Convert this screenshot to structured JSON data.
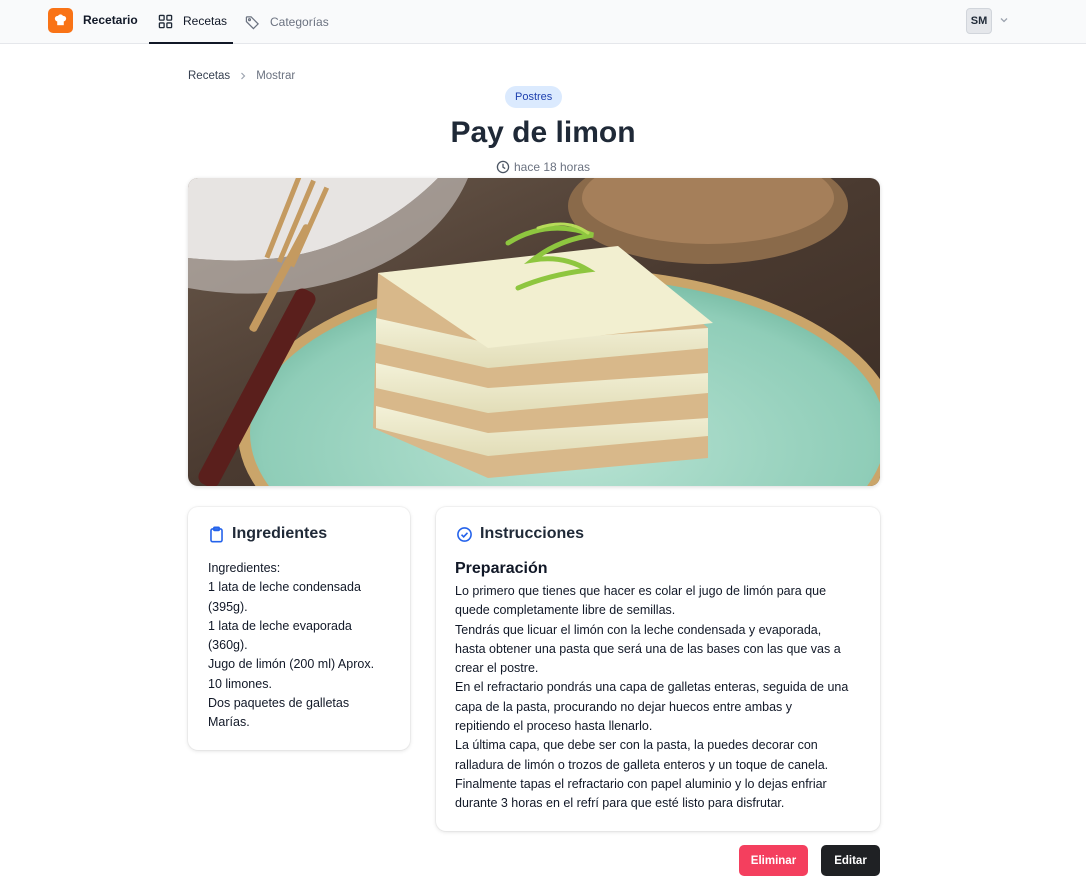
{
  "header": {
    "brand": "Recetario",
    "tabs": [
      {
        "label": "Recetas",
        "icon": "grid-icon",
        "active": true
      },
      {
        "label": "Categorías",
        "icon": "tag-icon",
        "active": false
      }
    ],
    "user_initials": "SM"
  },
  "breadcrumb": {
    "parent": "Recetas",
    "current": "Mostrar"
  },
  "recipe": {
    "category": "Postres",
    "title": "Pay de limon",
    "time_ago": "hace 18 horas",
    "image_alt": "Pay de limon"
  },
  "ingredients_card": {
    "heading": "Ingredientes",
    "lines": [
      "Ingredientes:",
      "1 lata de leche condensada",
      "(395g).",
      "1 lata de leche evaporada",
      "(360g).",
      "Jugo de limón (200 ml) Aprox.",
      "10 limones.",
      "Dos paquetes de galletas",
      "Marías."
    ]
  },
  "instructions_card": {
    "heading": "Instrucciones",
    "subheading": "Preparación",
    "lines": [
      "Lo primero que tienes que hacer es colar el jugo de limón para que",
      "quede completamente libre de semillas.",
      "Tendrás que licuar el limón con la leche condensada y evaporada,",
      "hasta obtener una pasta que será una de las bases con las que vas a",
      "crear el postre.",
      "En el refractario pondrás una capa de galletas enteras, seguida de una",
      "capa de la pasta, procurando no dejar huecos entre ambas y",
      "repitiendo el proceso hasta llenarlo.",
      "La última capa, que debe ser con la pasta, la puedes decorar con",
      "ralladura de limón o trozos de galleta enteros y un toque de canela.",
      "Finalmente tapas el refractario con papel aluminio y lo dejas enfriar",
      "durante 3 horas en el refrí para que esté listo para disfrutar."
    ]
  },
  "actions": {
    "delete_label": "Eliminar",
    "edit_label": "Editar"
  },
  "colors": {
    "brand": "#f97316",
    "badge_bg": "#dbeafe",
    "badge_text": "#1e40af",
    "delete": "#f43f5e",
    "edit": "#1f2124",
    "icon_accent": "#2563eb"
  }
}
